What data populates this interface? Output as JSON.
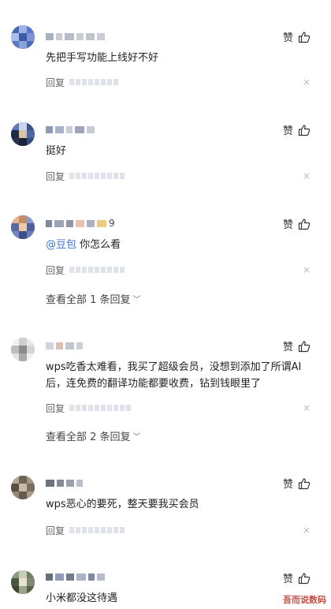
{
  "like_label": "赞",
  "reply_label": "回复",
  "close_glyph": "×",
  "comments": [
    {
      "text": "先把手写功能上线好不好"
    },
    {
      "text": "挺好"
    },
    {
      "mention": "@豆包",
      "text": " 你怎么看",
      "view_all": "查看全部 1 条回复",
      "name_suffix": "9"
    },
    {
      "text": "wps吃香太难看，我买了超级会员，没想到添加了所谓AI后，连免费的翻译功能都要收费，钻到钱眼里了",
      "view_all": "查看全部 2 条回复"
    },
    {
      "text": "wps恶心的要死，整天要我买会员"
    },
    {
      "text": "小米都没这待遇"
    }
  ],
  "chevron": "﹀",
  "watermark": "吾而说数码",
  "colors": {
    "accent_link": "#3a6fd8",
    "text": "#222222",
    "muted": "#666666"
  }
}
